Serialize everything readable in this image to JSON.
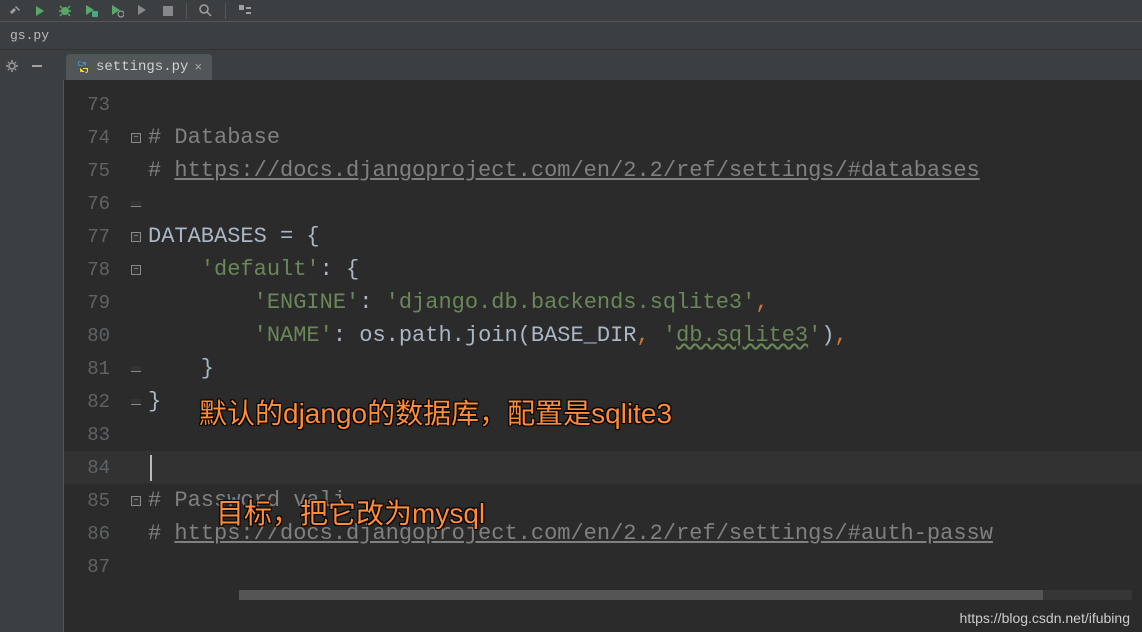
{
  "toolbar": {
    "icons": [
      "hammer",
      "play",
      "bug",
      "coverage",
      "profile",
      "attach",
      "stop",
      "sep",
      "search",
      "sep",
      "structure"
    ]
  },
  "upper_tab": {
    "label": "gs.py"
  },
  "editor_tab": {
    "label": "settings.py"
  },
  "code_lines": [
    {
      "n": "73",
      "fold": "line",
      "parts": []
    },
    {
      "n": "74",
      "fold": "top",
      "parts": [
        {
          "t": "# Database",
          "c": "comment"
        }
      ]
    },
    {
      "n": "75",
      "fold": "line",
      "parts": [
        {
          "t": "# ",
          "c": "comment"
        },
        {
          "t": "https://docs.djangoproject.com/en/2.2/ref/settings/#databases",
          "c": "comment-link"
        }
      ]
    },
    {
      "n": "76",
      "fold": "bot",
      "parts": []
    },
    {
      "n": "77",
      "fold": "top",
      "parts": [
        {
          "t": "DATABASES ",
          "c": "default"
        },
        {
          "t": "= {",
          "c": "default"
        }
      ]
    },
    {
      "n": "78",
      "fold": "top2",
      "parts": [
        {
          "t": "    ",
          "c": "default"
        },
        {
          "t": "'default'",
          "c": "key"
        },
        {
          "t": ": {",
          "c": "default"
        }
      ]
    },
    {
      "n": "79",
      "fold": "line",
      "parts": [
        {
          "t": "        ",
          "c": "default"
        },
        {
          "t": "'ENGINE'",
          "c": "key"
        },
        {
          "t": ": ",
          "c": "default"
        },
        {
          "t": "'django.db.backends.sqlite3'",
          "c": "string"
        },
        {
          "t": ",",
          "c": "punct"
        }
      ]
    },
    {
      "n": "80",
      "fold": "line",
      "parts": [
        {
          "t": "        ",
          "c": "default"
        },
        {
          "t": "'NAME'",
          "c": "key"
        },
        {
          "t": ": os.path.join(BASE_DIR",
          "c": "default"
        },
        {
          "t": ",",
          "c": "punct"
        },
        {
          "t": " ",
          "c": "default"
        },
        {
          "t": "'",
          "c": "string"
        },
        {
          "t": "db.sqlite3",
          "c": "string-link"
        },
        {
          "t": "'",
          "c": "string"
        },
        {
          "t": ")",
          "c": "default"
        },
        {
          "t": ",",
          "c": "punct"
        }
      ]
    },
    {
      "n": "81",
      "fold": "bot2",
      "parts": [
        {
          "t": "    }",
          "c": "default"
        }
      ]
    },
    {
      "n": "82",
      "fold": "bot",
      "parts": [
        {
          "t": "}",
          "c": "default"
        }
      ]
    },
    {
      "n": "83",
      "fold": "none",
      "parts": []
    },
    {
      "n": "84",
      "fold": "none",
      "current": true,
      "parts": [],
      "caret": true
    },
    {
      "n": "85",
      "fold": "top",
      "parts": [
        {
          "t": "# Password vali",
          "c": "comment"
        }
      ]
    },
    {
      "n": "86",
      "fold": "line",
      "parts": [
        {
          "t": "# ",
          "c": "comment"
        },
        {
          "t": "https://docs.djangoproject.com/en/2.2/ref/settings/#auth-passw",
          "c": "comment-link"
        }
      ]
    },
    {
      "n": "87",
      "fold": "line",
      "parts": []
    }
  ],
  "overlays": {
    "line1": "默认的django的数据库，配置是sqlite3",
    "line2": "目标，把它改为mysql"
  },
  "watermark": "https://blog.csdn.net/ifubing"
}
